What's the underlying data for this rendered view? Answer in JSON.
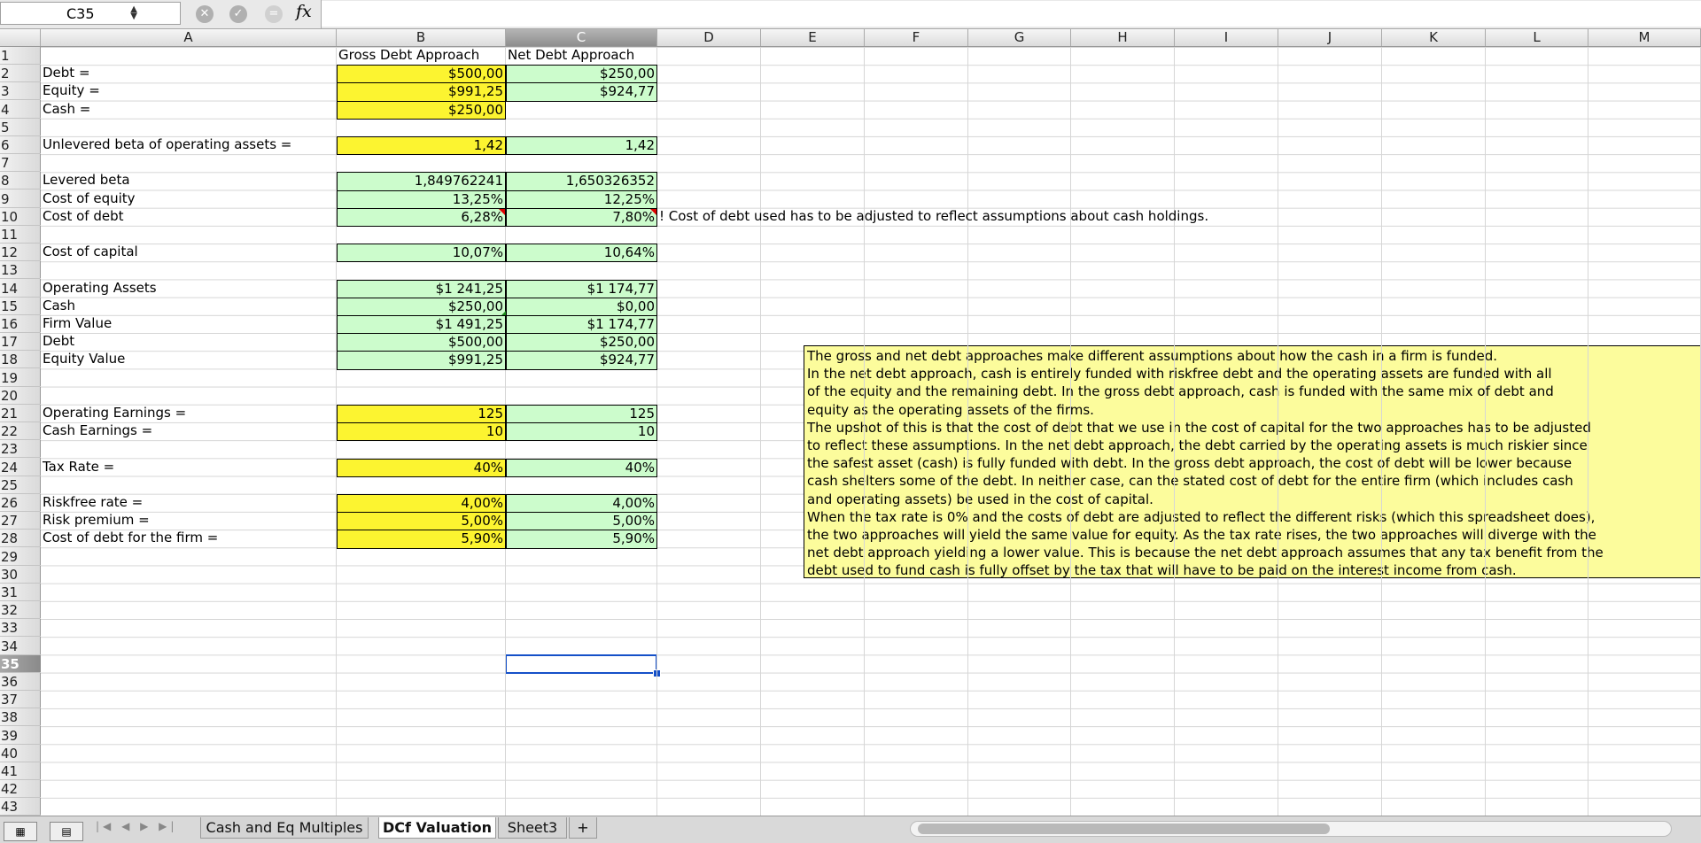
{
  "formula_bar": {
    "name_box": "C35",
    "fx_label": "fx",
    "formula": ""
  },
  "columns": [
    "A",
    "B",
    "C",
    "D",
    "E",
    "F",
    "G",
    "H",
    "I",
    "J",
    "K",
    "L",
    "M"
  ],
  "selected_column": "C",
  "rows": [
    1,
    2,
    3,
    4,
    5,
    6,
    7,
    8,
    9,
    10,
    11,
    12,
    13,
    14,
    15,
    16,
    17,
    18,
    19,
    20,
    21,
    22,
    23,
    24,
    25,
    26,
    27,
    28,
    29,
    30,
    31,
    32,
    33,
    34,
    35,
    36,
    37,
    38,
    39,
    40,
    41,
    42,
    43
  ],
  "selected_row": 35,
  "headers": {
    "b1": "Gross Debt Approach",
    "c1": "Net Debt Approach"
  },
  "labels": {
    "a2": "Debt =",
    "a3": "Equity =",
    "a4": "Cash =",
    "a6": "Unlevered beta of operating assets =",
    "a8": "Levered beta",
    "a9": "Cost of equity",
    "a10": "Cost of debt",
    "a12": "Cost of capital",
    "a14": "Operating Assets",
    "a15": "Cash",
    "a16": "Firm Value",
    "a17": "Debt",
    "a18": "Equity Value",
    "a21": "Operating Earnings =",
    "a22": "Cash Earnings =",
    "a24": "Tax Rate =",
    "a26": "Riskfree rate =",
    "a27": "Risk premium =",
    "a28": "Cost of debt for the firm ="
  },
  "values": {
    "b2": "$500,00",
    "c2": "$250,00",
    "b3": "$991,25",
    "c3": "$924,77",
    "b4": "$250,00",
    "b6": "1,42",
    "c6": "1,42",
    "b8": "1,849762241",
    "c8": "1,650326352",
    "b9": "13,25%",
    "c9": "12,25%",
    "b10": "6,28%",
    "c10": "7,80%",
    "b12": "10,07%",
    "c12": "10,64%",
    "b14": "$1 241,25",
    "c14": "$1 174,77",
    "b15": "$250,00",
    "c15": "$0,00",
    "b16": "$1 491,25",
    "c16": "$1 174,77",
    "b17": "$500,00",
    "c17": "$250,00",
    "b18": "$991,25",
    "c18": "$924,77",
    "b21": "125",
    "c21": "125",
    "b22": "10",
    "c22": "10",
    "b24": "40%",
    "c24": "40%",
    "b26": "4,00%",
    "c26": "4,00%",
    "b27": "5,00%",
    "c27": "5,00%",
    "b28": "5,90%",
    "c28": "5,90%"
  },
  "note_d10": "! Cost of debt used has to be adjusted to reflect assumptions about cash holdings.",
  "textbox_lines": [
    "The gross and net debt approaches make different assumptions about how the cash in a firm is funded.",
    "In  the net debt approach, cash is entirely funded with riskfree debt and the operating assets are funded with all",
    "of the equity and the remaining debt. In the gross debt approach, cash is funded with the same mix of debt and",
    "equity as the operating assets of the firms.",
    "The upshot of this is that the cost of debt that we use in the cost of capital for the two approaches has to be adjusted",
    "to reflect these assumptions. In the net debt approach, the debt carried by the operating assets is much riskier since",
    "the safest asset (cash) is fully funded with debt. In the gross debt approach, the cost of debt will be lower because",
    "cash shelters some of the debt. In neither case, can the stated cost of debt for the entire firm (which includes cash",
    "and operating assets) be used in the cost of capital.",
    "When the tax rate is 0% and the costs of debt are adjusted to reflect the different risks (which this spreadsheet does),",
    "the two approaches will yield the same value for equity. As the tax rate rises, the two approaches will diverge with the",
    "net debt approach yielding a lower value. This is because the net debt approach assumes that any tax benefit from the",
    "debt used to fund cash is fully offset by the tax that will have to be paid on the interest income from cash."
  ],
  "tabs": [
    {
      "label": "Cash and Eq Multiples",
      "active": false
    },
    {
      "label": "DCf Valuation",
      "active": true
    },
    {
      "label": "Sheet3",
      "active": false
    }
  ],
  "add_sheet": "+",
  "colors": {
    "yellow": "#fcf430",
    "green": "#ccfccc",
    "note": "#fcfc9c",
    "selection": "#1550c8"
  }
}
